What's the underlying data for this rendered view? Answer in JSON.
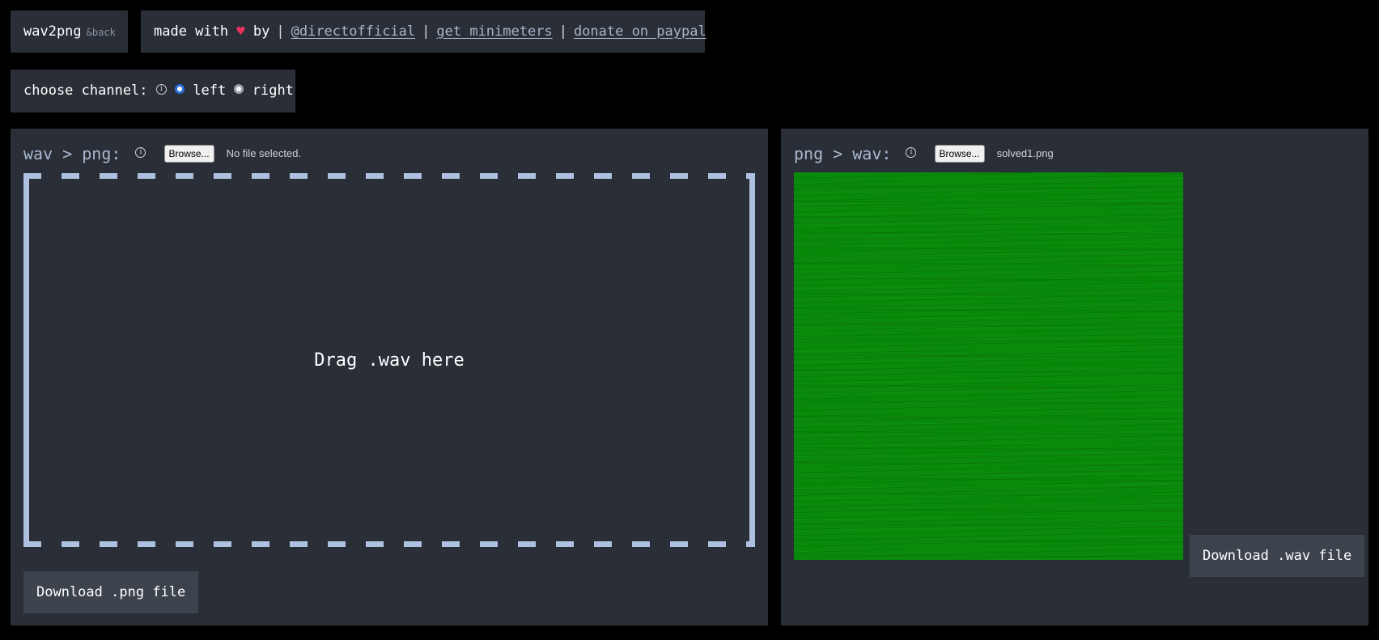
{
  "header": {
    "app_name": "wav2png",
    "app_suffix": "&back",
    "credits": {
      "made_with": "made with",
      "heart_glyph": "♥",
      "by": "by",
      "separator": "|",
      "links": [
        {
          "label": "@directofficial"
        },
        {
          "label": "get minimeters"
        },
        {
          "label": "donate on paypal"
        }
      ]
    }
  },
  "channel": {
    "label": "choose channel:",
    "info_glyph": "i",
    "options": [
      {
        "label": "left",
        "selected": true
      },
      {
        "label": "right",
        "selected": false
      }
    ]
  },
  "wav_to_png": {
    "title": "wav > png:",
    "info_glyph": "i",
    "browse_label": "Browse...",
    "file_status": "No file selected.",
    "drop_text": "Drag .wav here",
    "download_label": "Download .png file"
  },
  "png_to_wav": {
    "title": "png > wav:",
    "info_glyph": "i",
    "browse_label": "Browse...",
    "file_status": "solved1.png",
    "download_label": "Download .wav file"
  },
  "colors": {
    "background": "#000000",
    "panel": "#2a2f37",
    "accent_text": "#a9b8cf",
    "drop_border": "#aec1e0",
    "heart": "#e8335f",
    "preview_green": "#0a8a0a"
  }
}
